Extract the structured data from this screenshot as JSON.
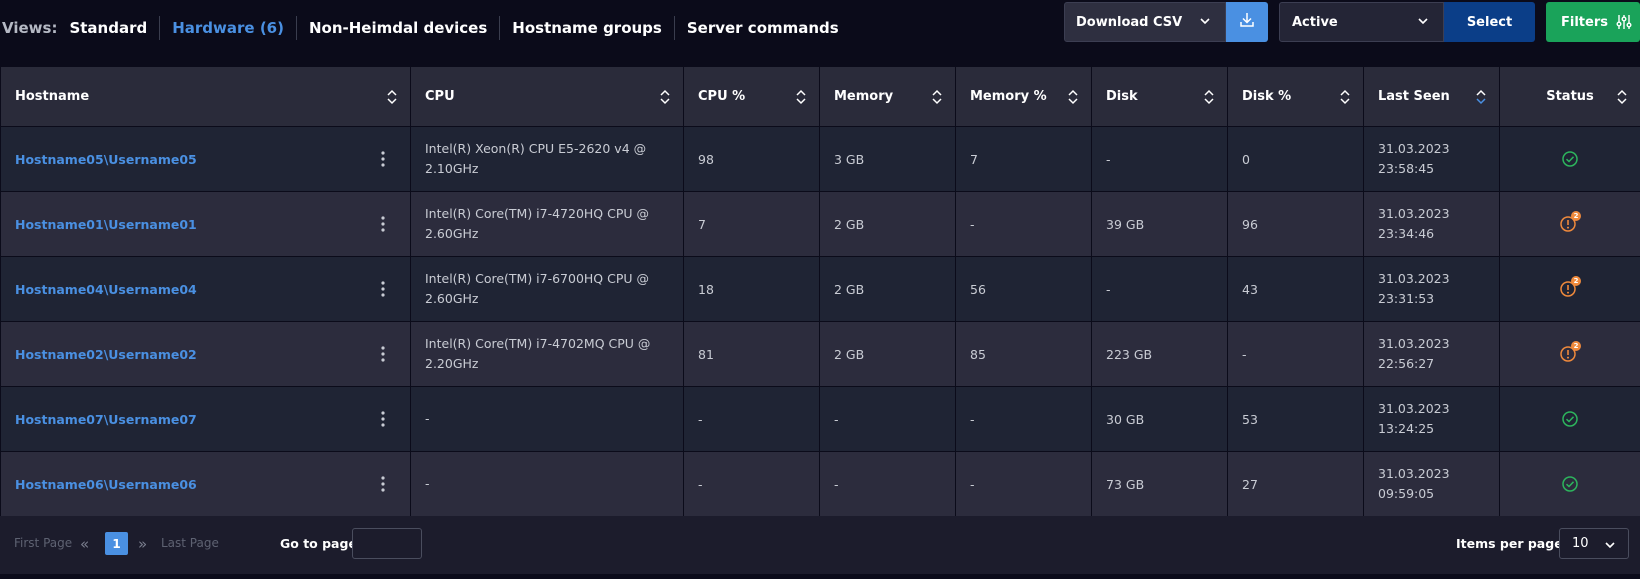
{
  "views": {
    "label": "Views:",
    "tabs": [
      {
        "label": "Standard",
        "active": false
      },
      {
        "label": "Hardware (6)",
        "active": true
      },
      {
        "label": "Non-Heimdal devices",
        "active": false
      },
      {
        "label": "Hostname groups",
        "active": false
      },
      {
        "label": "Server commands",
        "active": false
      }
    ]
  },
  "toolbar": {
    "download_label": "Download CSV",
    "state_value": "Active",
    "select_label": "Select",
    "filters_label": "Filters"
  },
  "table": {
    "columns": [
      "Hostname",
      "CPU",
      "CPU %",
      "Memory",
      "Memory %",
      "Disk",
      "Disk %",
      "Last Seen",
      "Status"
    ],
    "rows": [
      {
        "hostname": "Hostname05\\Username05",
        "cpu": "Intel(R) Xeon(R) CPU E5-2620 v4 @ 2.10GHz",
        "cpu_pct": "98",
        "memory": "3 GB",
        "memory_pct": "7",
        "disk": "-",
        "disk_pct": "0",
        "last_seen_date": "31.03.2023",
        "last_seen_time": "23:58:45",
        "status": "ok",
        "alerts": ""
      },
      {
        "hostname": "Hostname01\\Username01",
        "cpu": "Intel(R) Core(TM) i7-4720HQ CPU @ 2.60GHz",
        "cpu_pct": "7",
        "memory": "2 GB",
        "memory_pct": "-",
        "disk": "39 GB",
        "disk_pct": "96",
        "last_seen_date": "31.03.2023",
        "last_seen_time": "23:34:46",
        "status": "warning",
        "alerts": "2"
      },
      {
        "hostname": "Hostname04\\Username04",
        "cpu": "Intel(R) Core(TM) i7-6700HQ CPU @ 2.60GHz",
        "cpu_pct": "18",
        "memory": "2 GB",
        "memory_pct": "56",
        "disk": "-",
        "disk_pct": "43",
        "last_seen_date": "31.03.2023",
        "last_seen_time": "23:31:53",
        "status": "warning",
        "alerts": "2"
      },
      {
        "hostname": "Hostname02\\Username02",
        "cpu": "Intel(R) Core(TM) i7-4702MQ CPU @ 2.20GHz",
        "cpu_pct": "81",
        "memory": "2 GB",
        "memory_pct": "85",
        "disk": "223 GB",
        "disk_pct": "-",
        "last_seen_date": "31.03.2023",
        "last_seen_time": "22:56:27",
        "status": "warning",
        "alerts": "2"
      },
      {
        "hostname": "Hostname07\\Username07",
        "cpu": "-",
        "cpu_pct": "-",
        "memory": "-",
        "memory_pct": "-",
        "disk": "30 GB",
        "disk_pct": "53",
        "last_seen_date": "31.03.2023",
        "last_seen_time": "13:24:25",
        "status": "ok",
        "alerts": ""
      },
      {
        "hostname": "Hostname06\\Username06",
        "cpu": "-",
        "cpu_pct": "-",
        "memory": "-",
        "memory_pct": "-",
        "disk": "73 GB",
        "disk_pct": "27",
        "last_seen_date": "31.03.2023",
        "last_seen_time": "09:59:05",
        "status": "ok",
        "alerts": ""
      }
    ]
  },
  "pagination": {
    "first_label": "First Page",
    "current_page": "1",
    "last_label": "Last Page",
    "goto_label": "Go to page:",
    "goto_value": "",
    "items_label": "Items per page:",
    "items_value": "10"
  },
  "colors": {
    "accent": "#4a90e2",
    "ok": "#2db55d",
    "warning": "#f08a3c",
    "filters": "#1aa35a",
    "select": "#0b3e88"
  }
}
